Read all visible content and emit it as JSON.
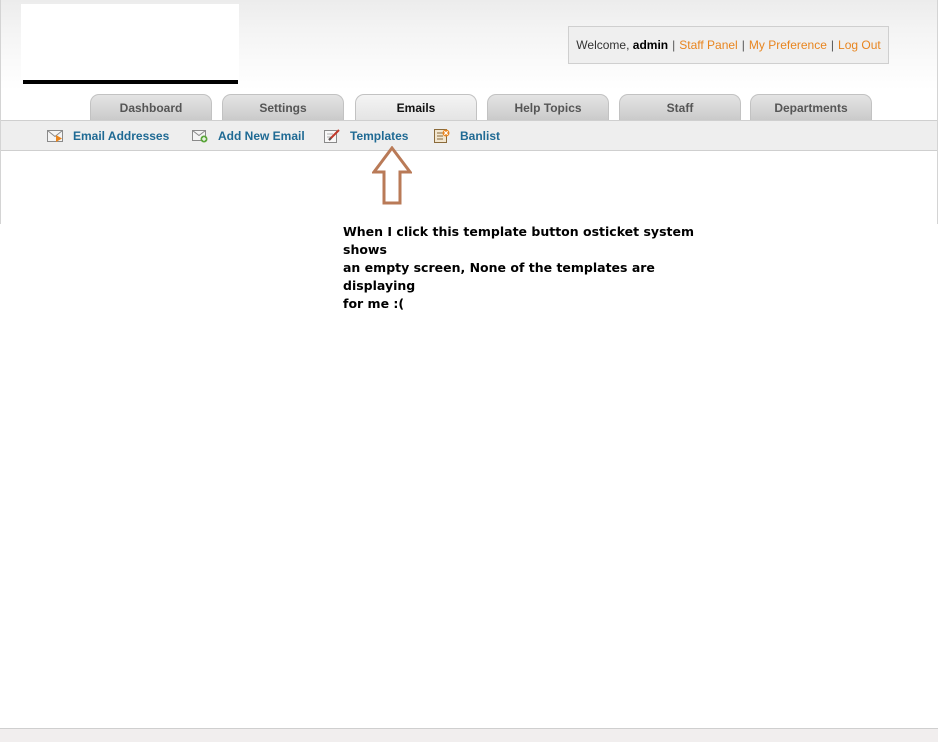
{
  "header": {
    "welcome_prefix": "Welcome,",
    "username": "admin",
    "separator": "|",
    "links": [
      "Staff Panel",
      "My Preference",
      "Log Out"
    ]
  },
  "tabs": [
    {
      "label": "Dashboard",
      "active": false
    },
    {
      "label": "Settings",
      "active": false
    },
    {
      "label": "Emails",
      "active": true
    },
    {
      "label": "Help Topics",
      "active": false
    },
    {
      "label": "Staff",
      "active": false
    },
    {
      "label": "Departments",
      "active": false
    }
  ],
  "subnav": {
    "items": [
      {
        "label": "Email Addresses",
        "icon": "email-icon"
      },
      {
        "label": "Add New Email",
        "icon": "email-add-icon"
      },
      {
        "label": "Templates",
        "icon": "template-edit-icon"
      },
      {
        "label": "Banlist",
        "icon": "banlist-icon"
      }
    ]
  },
  "annotation": {
    "lines": [
      "When I click this template button osticket system shows",
      "an empty screen, None of the templates are displaying",
      "for me :("
    ],
    "arrow_icon": "up-arrow-icon"
  },
  "colors": {
    "link_orange": "#e8851f",
    "subnav_blue": "#1f6a94",
    "arrow_brown": "#b97a57"
  }
}
